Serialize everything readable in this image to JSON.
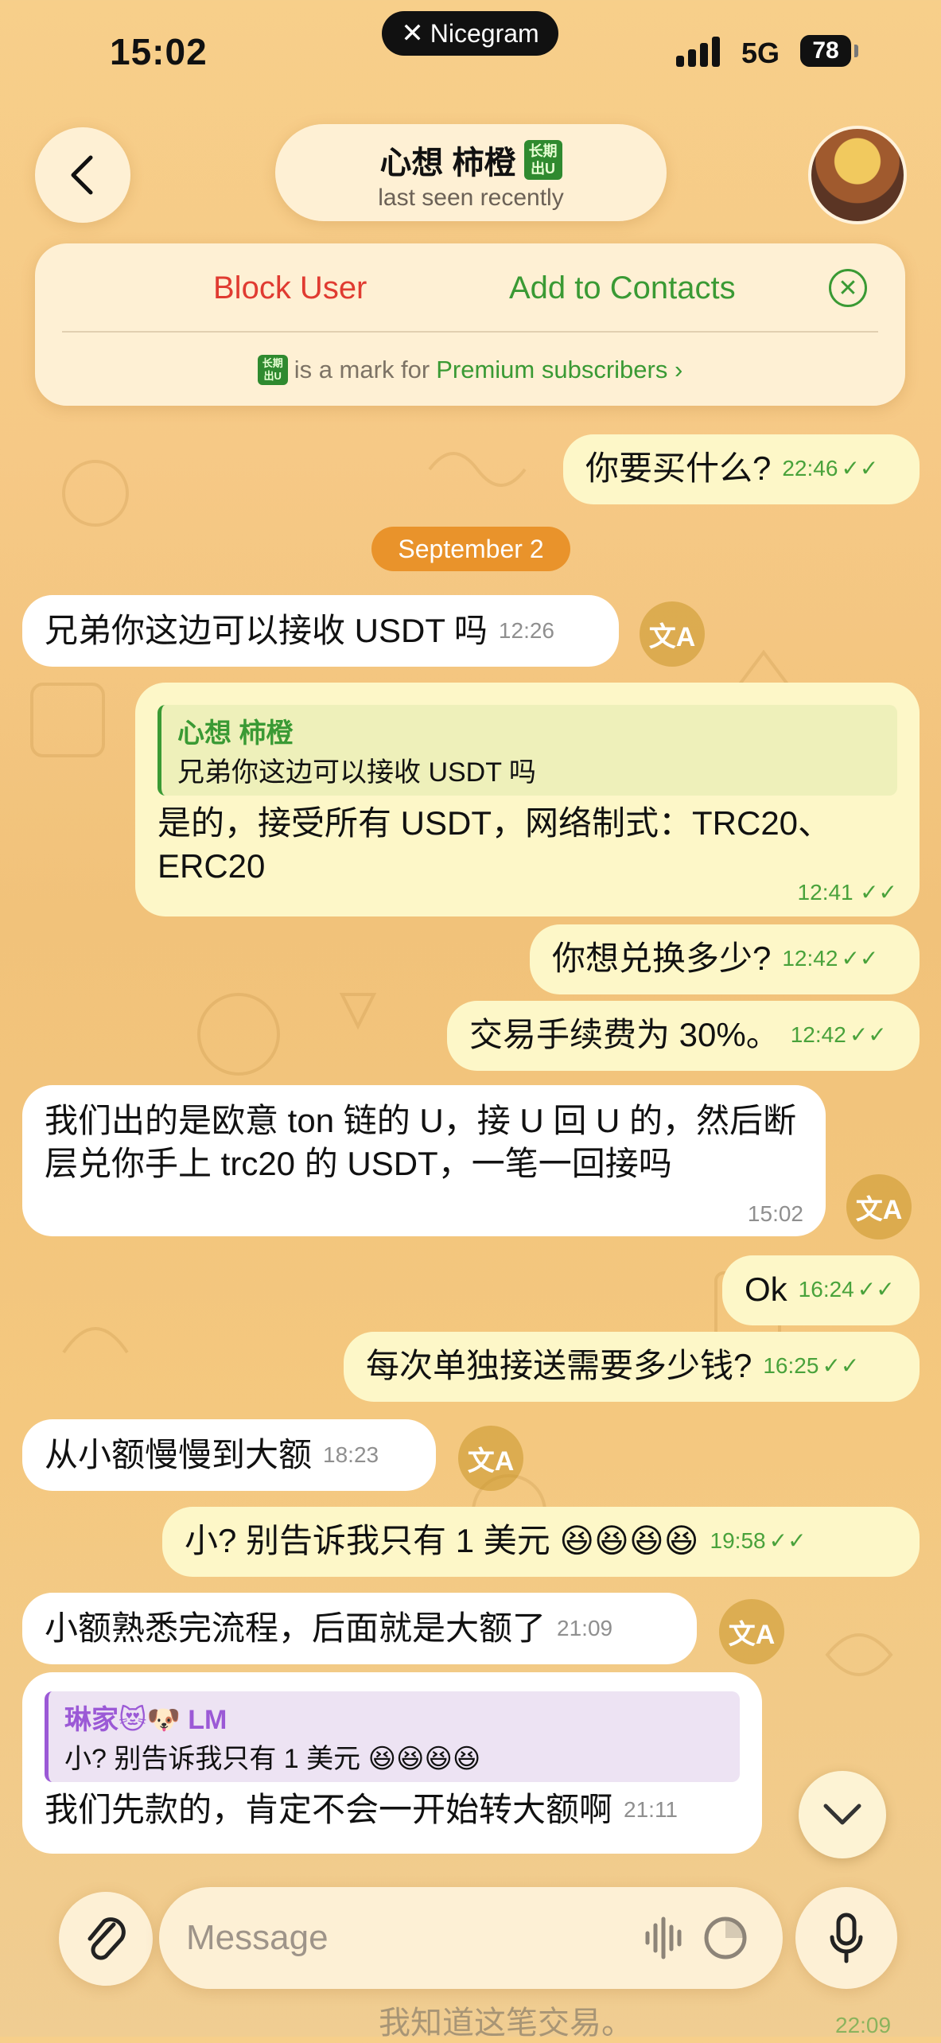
{
  "status": {
    "time": "15:02",
    "carrier_app": "Nicegram",
    "network": "5G",
    "battery": "78"
  },
  "header": {
    "name": "心想 柿橙",
    "badge": "长期 出U",
    "subtitle": "last seen recently"
  },
  "actions": {
    "block": "Block User",
    "add": "Add to Contacts",
    "note_prefix": "is a mark for",
    "note_link": "Premium subscribers ›"
  },
  "date_separator": "September 2",
  "messages": [
    {
      "dir": "out",
      "text": "你要买什么?",
      "time": "22:46",
      "checks": "✓✓"
    },
    {
      "dir": "in",
      "text": "兄弟你这边可以接收 USDT 吗",
      "time": "12:26"
    },
    {
      "dir": "out",
      "reply_name": "心想 柿橙",
      "reply_text": "兄弟你这边可以接收 USDT 吗",
      "text": "是的，接受所有 USDT，网络制式：TRC20、ERC20",
      "time": "12:41",
      "checks": "✓✓"
    },
    {
      "dir": "out",
      "text": "你想兑换多少?",
      "time": "12:42",
      "checks": "✓✓"
    },
    {
      "dir": "out",
      "text": "交易手续费为 30%。",
      "time": "12:42",
      "checks": "✓✓"
    },
    {
      "dir": "in",
      "text": "我们出的是欧意 ton 链的 U，接 U 回 U 的，然后断层兑你手上 trc20 的 USDT，一笔一回接吗",
      "time": "15:02"
    },
    {
      "dir": "out",
      "text": "Ok",
      "time": "16:24",
      "checks": "✓✓"
    },
    {
      "dir": "out",
      "text": "每次单独接送需要多少钱?",
      "time": "16:25",
      "checks": "✓✓"
    },
    {
      "dir": "in",
      "text": "从小额慢慢到大额",
      "time": "18:23"
    },
    {
      "dir": "out",
      "text": "小? 别告诉我只有 1 美元 😆😆😆😆",
      "time": "19:58",
      "checks": "✓✓"
    },
    {
      "dir": "in",
      "text": "小额熟悉完流程，后面就是大额了",
      "time": "21:09"
    },
    {
      "dir": "in",
      "reply_name": "琳家😻🐶 LM",
      "reply_text": "小? 别告诉我只有 1 美元 😆😆😆😆",
      "text": "我们先款的，肯定不会一开始转大额啊",
      "time": "21:11"
    }
  ],
  "translate_icon": "文A",
  "composer": {
    "placeholder": "Message"
  },
  "ghost_text": "我知道这笔交易。",
  "ghost_time": "22:09"
}
